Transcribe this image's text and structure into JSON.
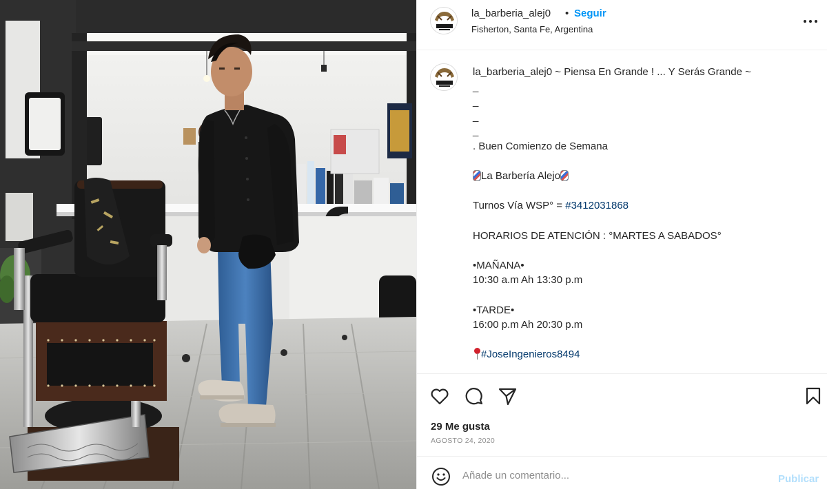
{
  "photo": {
    "alt_subject": "barber-shop-photo"
  },
  "header": {
    "username": "la_barberia_alej0",
    "separator": "•",
    "follow_label": "Seguir",
    "location": "Fisherton, Santa Fe, Argentina",
    "more_icon": "more-horizontal-icon"
  },
  "caption": {
    "username": "la_barberia_alej0",
    "title_text": " ~ Piensa En Grande ! ... Y Serás Grande ~",
    "dash_1": "_",
    "dash_2": "_",
    "dash_3": "_",
    "dash_4": "_",
    "greeting": ". Buen Comienzo de Semana",
    "shop_name": "La Barbería Alejo",
    "turnos_label": "Turnos Vía WSP° = ",
    "phone_tag": "#3412031868",
    "hours_label": "HORARIOS DE ATENCIÓN : °MARTES A SABADOS°",
    "morning_label": "•MAÑANA•",
    "morning_hours": "10:30 a.m Ah 13:30 p.m",
    "afternoon_label": "•TARDE•",
    "afternoon_hours": "16:00 p.m Ah 20:30 p.m",
    "address_tag": "#JoseIngenieros8494"
  },
  "actions": {
    "like_icon": "heart-icon",
    "comment_icon": "comment-icon",
    "share_icon": "send-icon",
    "save_icon": "bookmark-icon",
    "likes_text": "29 Me gusta",
    "date_text": "AGOSTO 24, 2020"
  },
  "composer": {
    "emoji_icon": "emoji-icon",
    "placeholder": "Añade un comentario...",
    "post_label": "Publicar"
  },
  "colors": {
    "link_blue": "#0095f6",
    "hashtag_blue": "#00376b",
    "post_disabled": "#b2dffc",
    "muted_gray": "#8e8e8e"
  }
}
